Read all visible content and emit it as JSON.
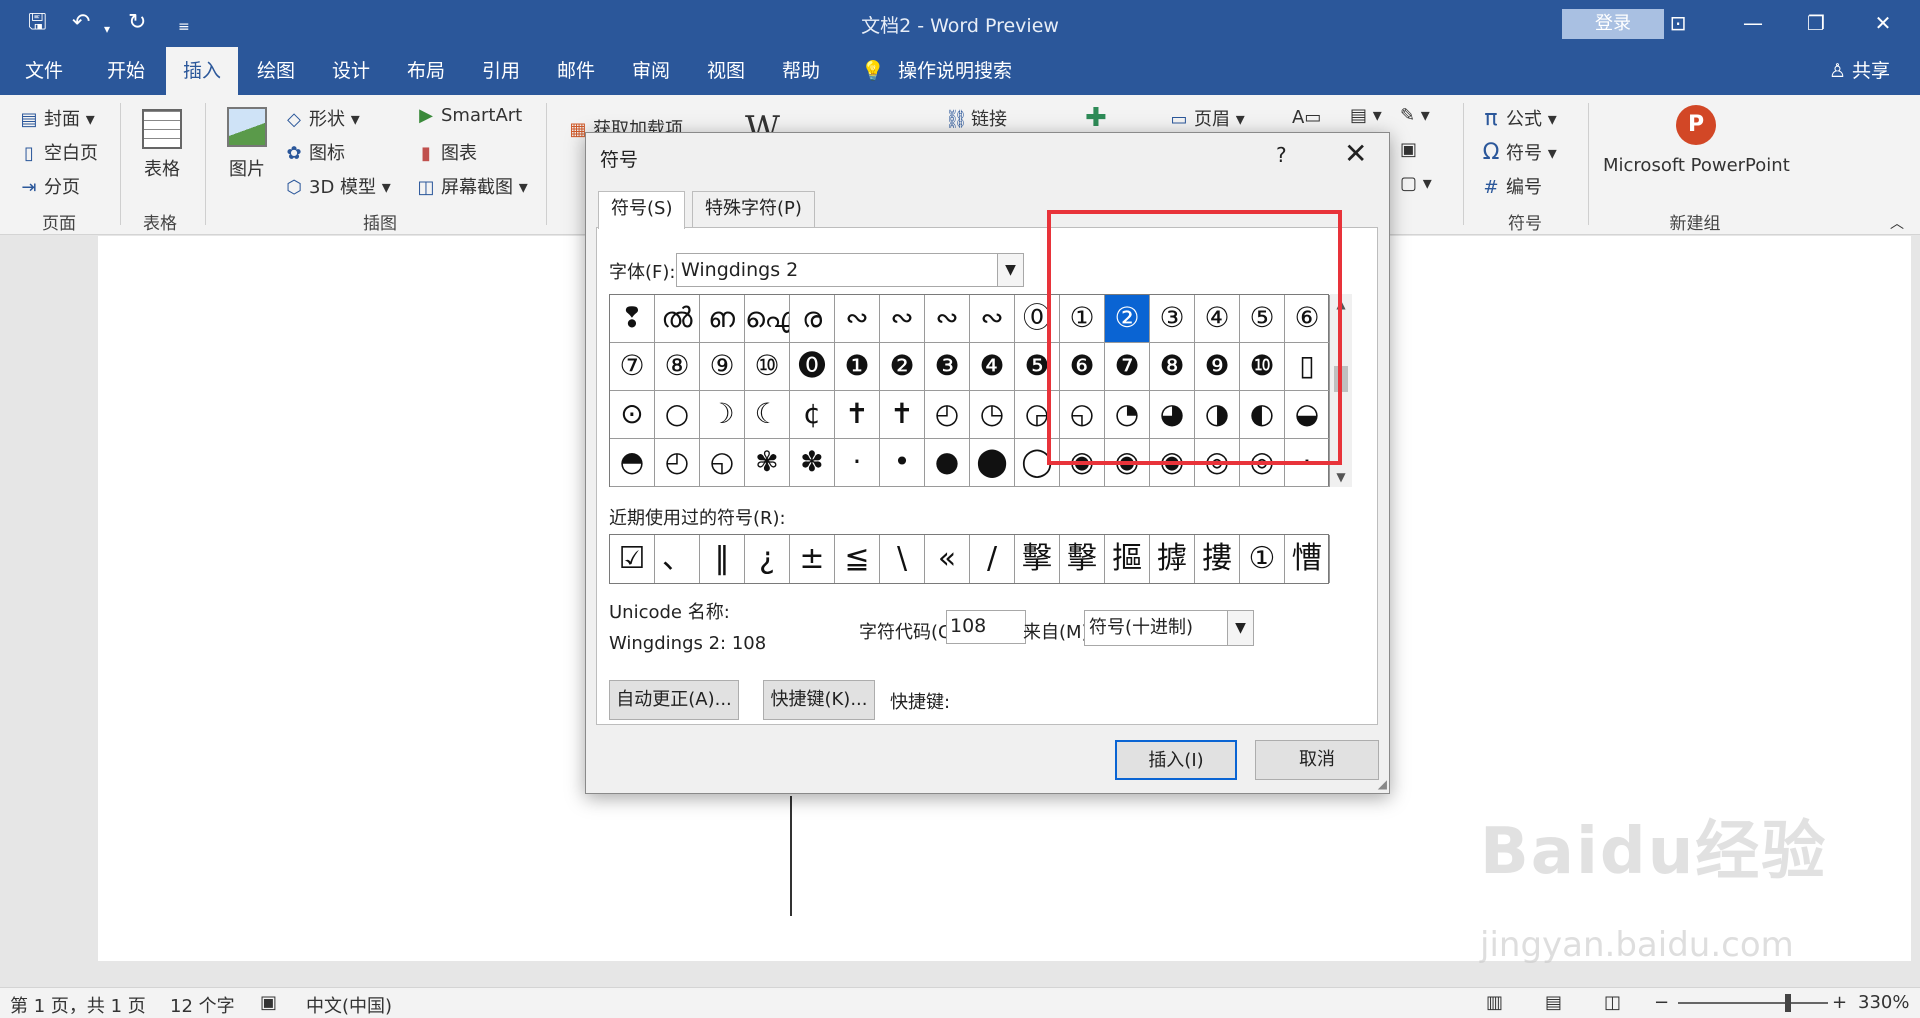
{
  "window": {
    "doc_title": "文档2 - Word Preview",
    "login": "登录",
    "controls": {
      "ribbon_display": "⊡",
      "minimize": "—",
      "restore": "❐",
      "close": "✕"
    }
  },
  "menu": {
    "tabs": [
      "文件",
      "开始",
      "插入",
      "绘图",
      "设计",
      "布局",
      "引用",
      "邮件",
      "审阅",
      "视图",
      "帮助"
    ],
    "active_tab": "插入",
    "search": "操作说明搜索",
    "share": "共享"
  },
  "ribbon": {
    "pages": {
      "cover": "封面",
      "blank": "空白页",
      "break": "分页",
      "label": "页面"
    },
    "tables": {
      "table": "表格",
      "label": "表格"
    },
    "illustrations": {
      "picture": "图片",
      "shapes": "形状",
      "icons": "图标",
      "model3d": "3D 模型",
      "smartart": "SmartArt",
      "chart": "图表",
      "screenshot": "屏幕截图",
      "label": "插图"
    },
    "addins": {
      "get": "获取加载项"
    },
    "links": {
      "link": "链接"
    },
    "header": {
      "header": "页眉"
    },
    "symbols": {
      "equation": "公式",
      "symbol": "符号",
      "number": "编号",
      "label": "符号"
    },
    "newgroup": {
      "ppt": "Microsoft PowerPoint",
      "label": "新建组"
    }
  },
  "dialog": {
    "title": "符号",
    "help": "?",
    "close": "✕",
    "tabs": [
      "符号(S)",
      "特殊字符(P)"
    ],
    "font_label": "字体(F):",
    "font_value": "Wingdings 2",
    "symbols": [
      [
        "❢",
        "ൽ",
        "ഩ",
        "ഐ",
        "ര",
        "∾",
        "∾",
        "∾",
        "∾",
        "⓪",
        "①",
        "②",
        "③",
        "④",
        "⑤",
        "⑥"
      ],
      [
        "⑦",
        "⑧",
        "⑨",
        "⑩",
        "⓿",
        "❶",
        "❷",
        "❸",
        "❹",
        "❺",
        "❻",
        "❼",
        "❽",
        "❾",
        "❿",
        "▯"
      ],
      [
        "⊙",
        "○",
        "☽",
        "☾",
        "¢",
        "✝",
        "✝",
        "◴",
        "◷",
        "◶",
        "◵",
        "◔",
        "◕",
        "◑",
        "◐",
        "◒"
      ],
      [
        "◓",
        "◴",
        "◵",
        "✾",
        "✽",
        "·",
        "•",
        "●",
        "⬤",
        "◯",
        "◉",
        "◉",
        "◉",
        "◎",
        "◎",
        "·"
      ]
    ],
    "selected_symbol": "③",
    "recent_label": "近期使用过的符号(R):",
    "recent_symbols": [
      "☑",
      "、",
      "‖",
      "¿",
      "±",
      "≦",
      "\\",
      "«",
      "/",
      "擊",
      "擊",
      "摳",
      "摢",
      "摟",
      "①",
      "慒"
    ],
    "unicode_label": "Unicode 名称:",
    "unicode_value": "Wingdings 2: 108",
    "code_label": "字符代码(C):",
    "code_value": "108",
    "from_label": "来自(M):",
    "from_value": "符号(十进制)",
    "autocorrect_btn": "自动更正(A)...",
    "shortcut_btn": "快捷键(K)...",
    "shortcut_label": "快捷键:",
    "insert_btn": "插入(I)",
    "cancel_btn": "取消"
  },
  "status": {
    "page": "第 1 页，共 1 页",
    "words": "12 个字",
    "language": "中文(中国)",
    "zoom": "330%"
  },
  "watermark": {
    "brand": "Baidu经验",
    "url": "jingyan.baidu.com"
  },
  "colors": {
    "brand": "#2b579a",
    "selection": "#0a64d3",
    "highlight": "#e8333a"
  }
}
